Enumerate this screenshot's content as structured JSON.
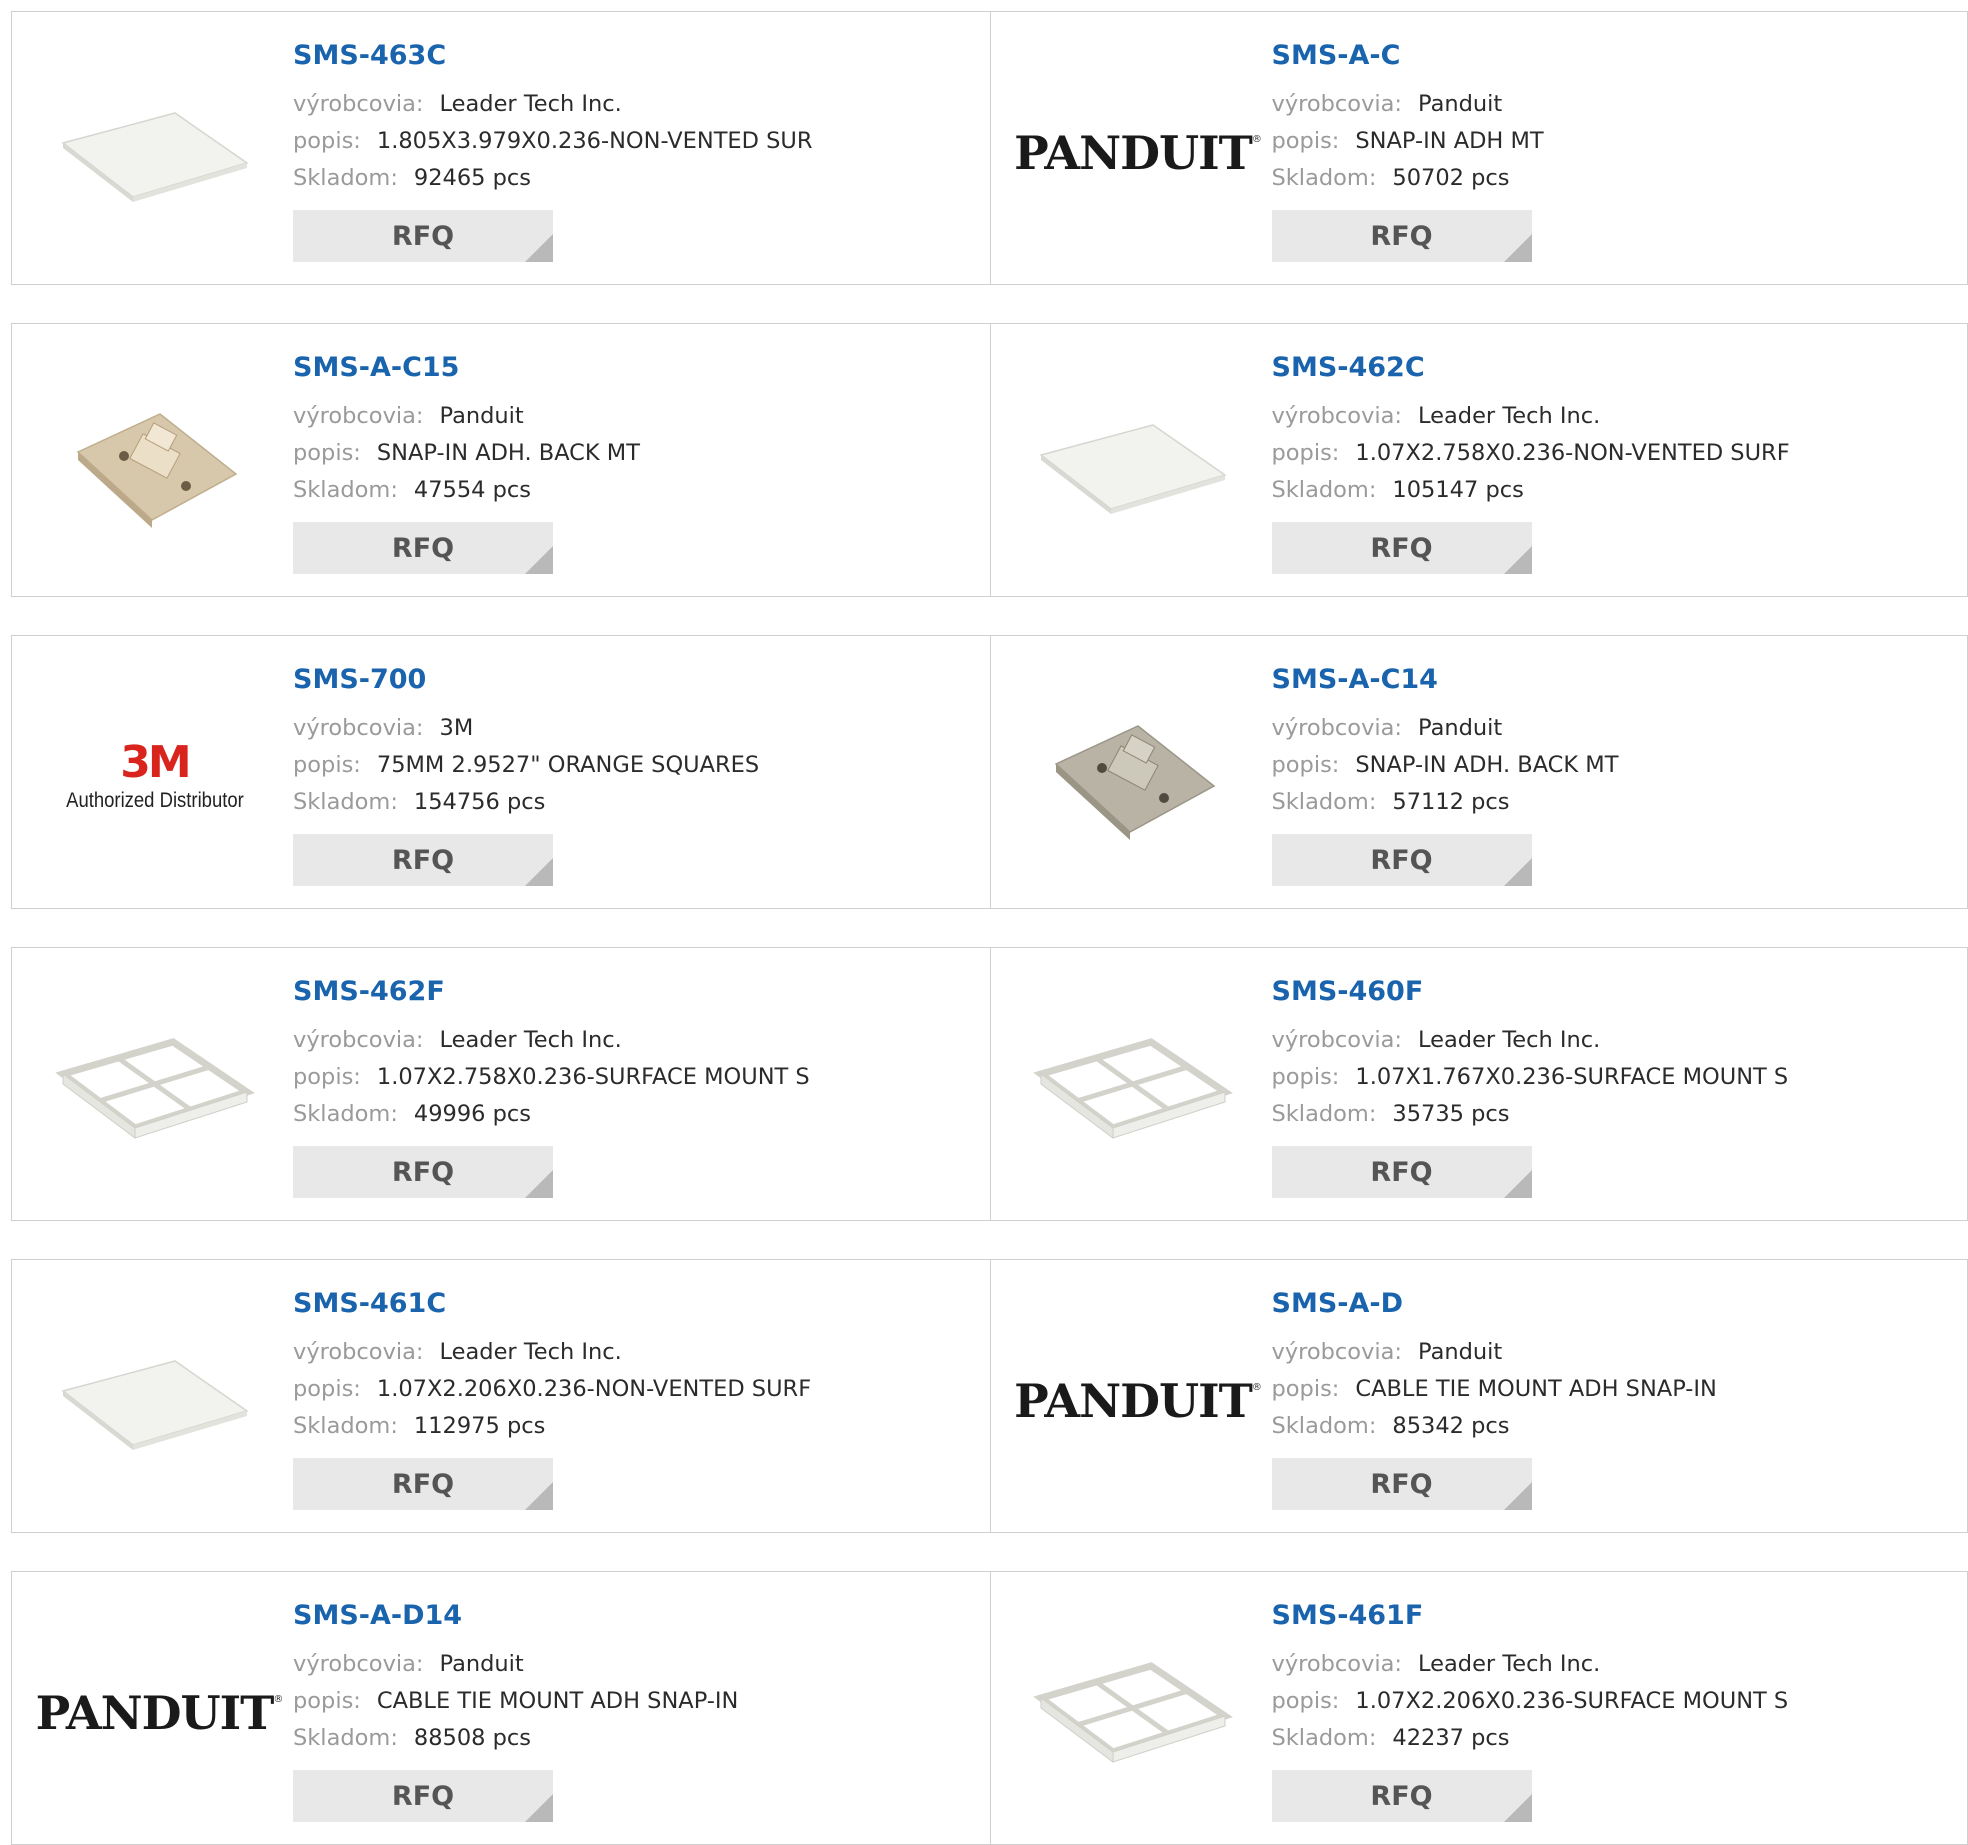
{
  "labels": {
    "manufacturer": "výrobcovia:",
    "description": "popis:",
    "stock": "Skladom:",
    "rfq": "RFQ"
  },
  "logos": {
    "panduit": "PANDUIT",
    "registered": "®",
    "mmm": "3M",
    "mmm_sub": "Authorized Distributor"
  },
  "products": [
    {
      "pn": "SMS-463C",
      "mfr": "Leader Tech Inc.",
      "desc": "1.805X3.979X0.236-NON-VENTED SUR",
      "stock": "92465 pcs",
      "image": "plain-panel-icon"
    },
    {
      "pn": "SMS-A-C",
      "mfr": "Panduit",
      "desc": "SNAP-IN ADH MT",
      "stock": "50702 pcs",
      "image": "panduit-logo"
    },
    {
      "pn": "SMS-A-C15",
      "mfr": "Panduit",
      "desc": "SNAP-IN ADH. BACK MT",
      "stock": "47554 pcs",
      "image": "cable-mount-tan-icon"
    },
    {
      "pn": "SMS-462C",
      "mfr": "Leader Tech Inc.",
      "desc": "1.07X2.758X0.236-NON-VENTED SURF",
      "stock": "105147 pcs",
      "image": "plain-panel-icon"
    },
    {
      "pn": "SMS-700",
      "mfr": "3M",
      "desc": "75MM 2.9527\" ORANGE SQUARES",
      "stock": "154756 pcs",
      "image": "3m-logo"
    },
    {
      "pn": "SMS-A-C14",
      "mfr": "Panduit",
      "desc": "SNAP-IN ADH. BACK MT",
      "stock": "57112 pcs",
      "image": "cable-mount-gray-icon"
    },
    {
      "pn": "SMS-462F",
      "mfr": "Leader Tech Inc.",
      "desc": "1.07X2.758X0.236-SURFACE MOUNT S",
      "stock": "49996 pcs",
      "image": "frame-icon"
    },
    {
      "pn": "SMS-460F",
      "mfr": "Leader Tech Inc.",
      "desc": "1.07X1.767X0.236-SURFACE MOUNT S",
      "stock": "35735 pcs",
      "image": "frame-icon"
    },
    {
      "pn": "SMS-461C",
      "mfr": "Leader Tech Inc.",
      "desc": "1.07X2.206X0.236-NON-VENTED SURF",
      "stock": "112975 pcs",
      "image": "plain-panel-icon"
    },
    {
      "pn": "SMS-A-D",
      "mfr": "Panduit",
      "desc": "CABLE TIE MOUNT ADH SNAP-IN",
      "stock": "85342 pcs",
      "image": "panduit-logo"
    },
    {
      "pn": "SMS-A-D14",
      "mfr": "Panduit",
      "desc": "CABLE TIE MOUNT ADH SNAP-IN",
      "stock": "88508 pcs",
      "image": "panduit-logo"
    },
    {
      "pn": "SMS-461F",
      "mfr": "Leader Tech Inc.",
      "desc": "1.07X2.206X0.236-SURFACE MOUNT S",
      "stock": "42237 pcs",
      "image": "frame-icon"
    }
  ]
}
